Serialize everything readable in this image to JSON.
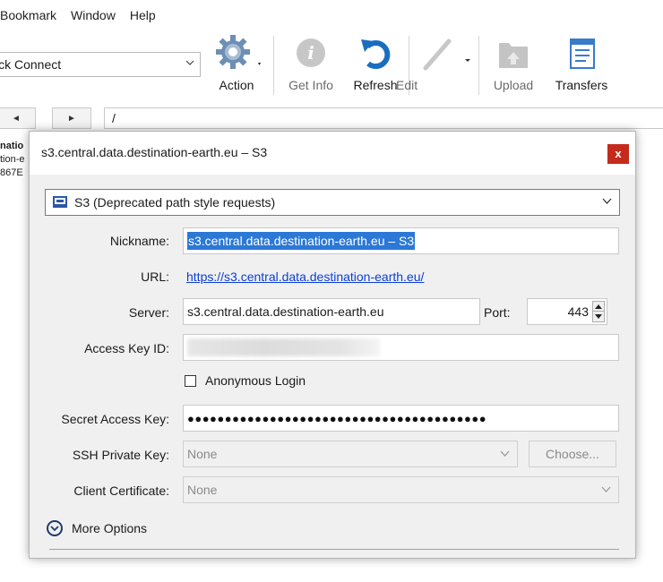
{
  "menubar": {
    "items": [
      "Bookmark",
      "Window",
      "Help"
    ]
  },
  "toolbar": {
    "quick_connect": "ick Connect",
    "action_label": "Action",
    "get_info_label": "Get Info",
    "refresh_label": "Refresh",
    "edit_label": "Edit",
    "upload_label": "Upload",
    "transfers_label": "Transfers"
  },
  "navbar": {
    "back_glyph": "◄",
    "forward_glyph": "►",
    "path": "/"
  },
  "background_list": {
    "line1": "natio",
    "line2": "tion-e",
    "line3": "867E"
  },
  "dialog": {
    "title": "s3.central.data.destination-earth.eu – S3",
    "close_glyph": "x",
    "protocol": "S3 (Deprecated path style requests)",
    "nickname_label": "Nickname:",
    "nickname_value": "s3.central.data.destination-earth.eu – S3",
    "url_label": "URL:",
    "url_value": "https://s3.central.data.destination-earth.eu/",
    "server_label": "Server:",
    "server_value": "s3.central.data.destination-earth.eu",
    "port_label": "Port:",
    "port_value": "443",
    "access_key_label": "Access Key ID:",
    "anonymous_login_label": "Anonymous Login",
    "anonymous_login_checked": false,
    "secret_key_label": "Secret Access Key:",
    "secret_key_value": "●●●●●●●●●●●●●●●●●●●●●●●●●●●●●●●●●●●●●●●●",
    "ssh_key_label": "SSH Private Key:",
    "ssh_key_value": "None",
    "choose_label": "Choose...",
    "client_cert_label": "Client Certificate:",
    "client_cert_value": "None",
    "more_options_label": "More Options"
  },
  "colors": {
    "close_button": "#c42b1c",
    "selection": "#2b78d6",
    "link": "#0b3fd6",
    "dialog_bg": "#f0f0f0"
  },
  "icons": {
    "action": "gear-icon",
    "get_info": "info-icon",
    "refresh": "refresh-icon",
    "edit": "pencil-icon",
    "upload": "upload-folder-icon",
    "transfers": "transfers-list-icon",
    "protocol": "s3-bucket-icon",
    "more_options": "chevron-down-circle-icon"
  }
}
